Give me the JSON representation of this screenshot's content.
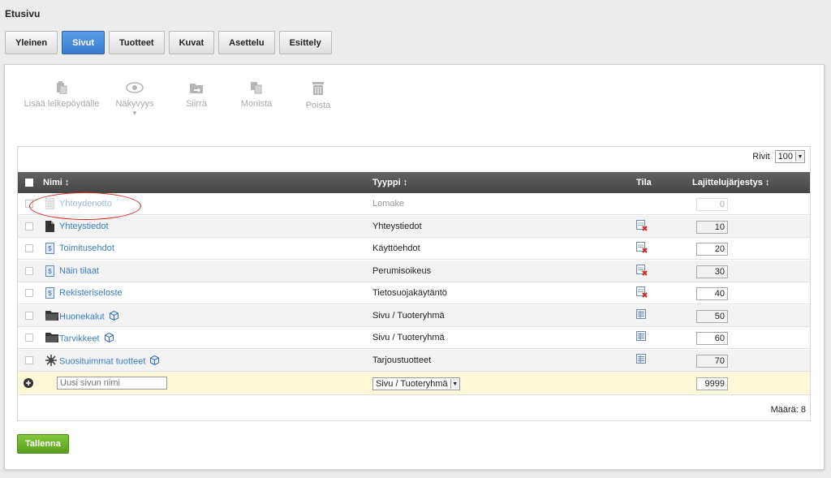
{
  "breadcrumb": "Etusivu",
  "tabs": [
    {
      "label": "Yleinen",
      "active": false
    },
    {
      "label": "Sivut",
      "active": true
    },
    {
      "label": "Tuotteet",
      "active": false
    },
    {
      "label": "Kuvat",
      "active": false
    },
    {
      "label": "Asettelu",
      "active": false
    },
    {
      "label": "Esittely",
      "active": false
    }
  ],
  "toolbar": {
    "paste_label": "Lisää leikepöydälle",
    "visibility_label": "Näkyvyys",
    "move_label": "Siirrä",
    "copy_label": "Monista",
    "delete_label": "Poista"
  },
  "grid": {
    "rows_label": "Rivit",
    "rows_value": "100",
    "columns": {
      "name": "Nimi",
      "type": "Tyyppi",
      "status": "Tila",
      "order": "Lajittelujärjestys"
    },
    "rows": [
      {
        "name": "Yhteydenotto",
        "type": "Lomake",
        "order": "0",
        "icon": "form-icon",
        "status": "none",
        "dimmed": true
      },
      {
        "name": "Yhteystiedot",
        "type": "Yhteystiedot",
        "order": "10",
        "icon": "page-icon",
        "status": "hidden"
      },
      {
        "name": "Toimitusehdot",
        "type": "Käyttöehdot",
        "order": "20",
        "icon": "text-page-icon",
        "status": "hidden"
      },
      {
        "name": "Näin tilaat",
        "type": "Perumisoikeus",
        "order": "30",
        "icon": "text-page-icon",
        "status": "hidden"
      },
      {
        "name": "Rekisteriseloste",
        "type": "Tietosuojakäytäntö",
        "order": "40",
        "icon": "text-page-icon",
        "status": "hidden"
      },
      {
        "name": "Huonekalut",
        "type": "Sivu / Tuoteryhmä",
        "order": "50",
        "icon": "folder-icon",
        "status": "visible",
        "product_group": true
      },
      {
        "name": "Tarvikkeet",
        "type": "Sivu / Tuoteryhmä",
        "order": "60",
        "icon": "folder-icon",
        "status": "visible",
        "product_group": true
      },
      {
        "name": "Suosituimmat tuotteet",
        "type": "Tarjoustuotteet",
        "order": "70",
        "icon": "star-burst-icon",
        "status": "visible",
        "product_group": true
      }
    ],
    "new_row": {
      "name_placeholder": "Uusi sivun nimi",
      "type_value": "Sivu / Tuoteryhmä",
      "order_value": "9999"
    },
    "count_label": "Määrä: 8"
  },
  "save_label": "Tallenna",
  "colors": {
    "accent": "#3a7bd0",
    "link": "#3b7dc4",
    "save": "#5a9e1c",
    "highlight_circle": "#dd2222",
    "header": "#454545"
  }
}
